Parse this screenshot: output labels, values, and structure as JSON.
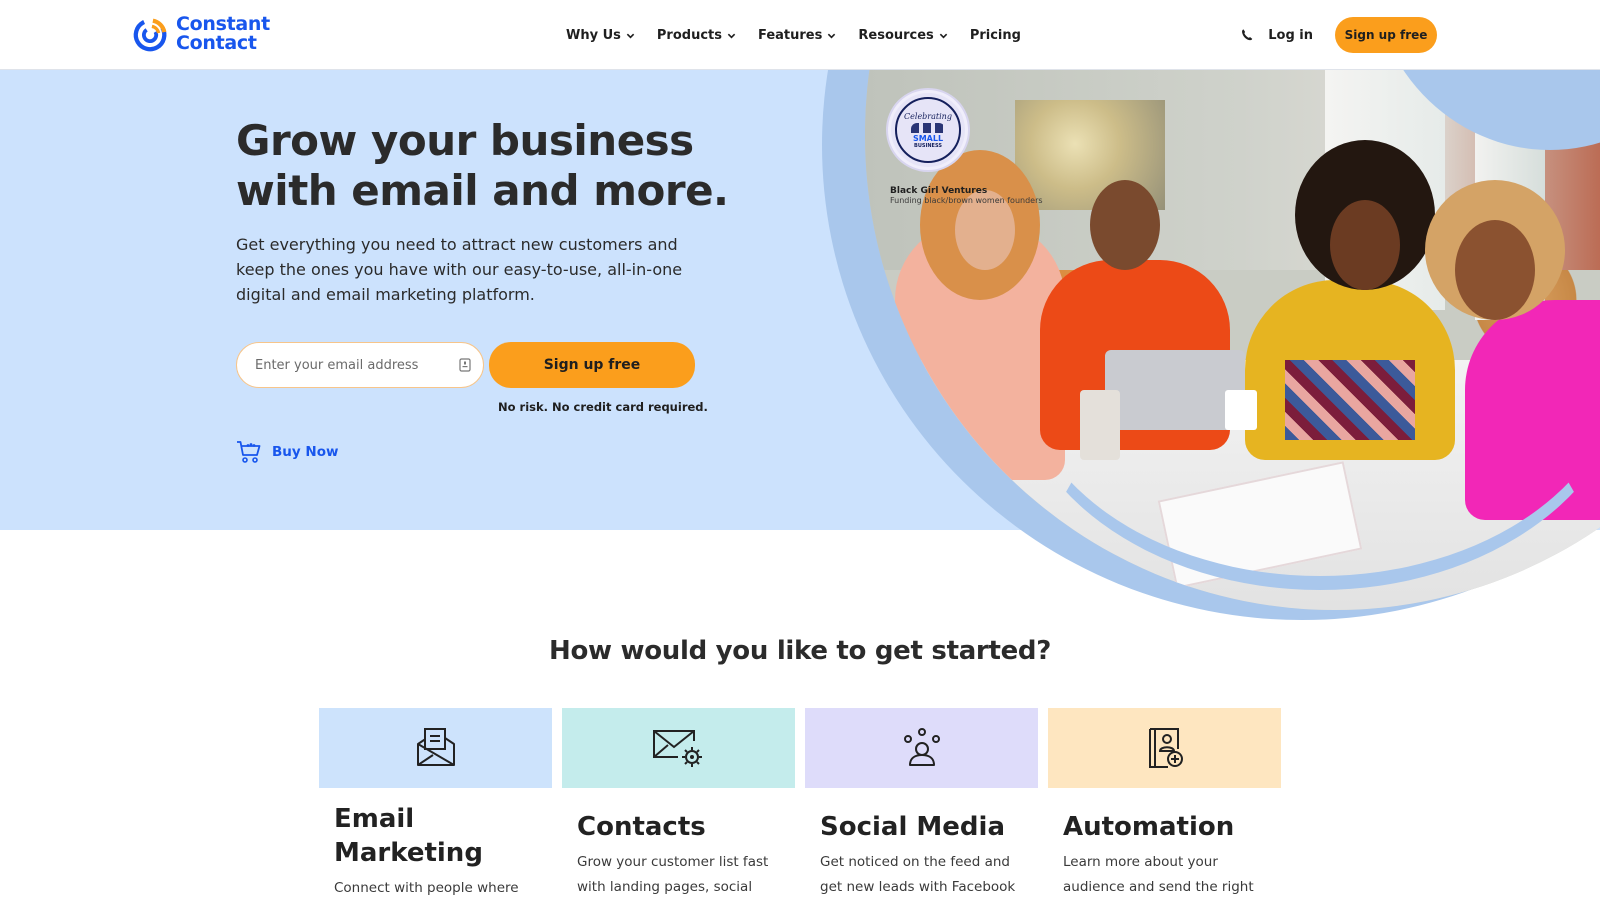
{
  "header": {
    "logo_line1": "Constant",
    "logo_line2": "Contact",
    "nav": [
      {
        "label": "Why Us",
        "has_dropdown": true
      },
      {
        "label": "Products",
        "has_dropdown": true
      },
      {
        "label": "Features",
        "has_dropdown": true
      },
      {
        "label": "Resources",
        "has_dropdown": true
      },
      {
        "label": "Pricing",
        "has_dropdown": false
      }
    ],
    "login_label": "Log in",
    "signup_label": "Sign up free"
  },
  "hero": {
    "title": "Grow your business with email and more.",
    "subtitle": "Get everything you need to attract new customers and keep the ones you have with our easy-to-use, all-in-one digital and email marketing platform.",
    "email_placeholder": "Enter your email address",
    "email_value": "",
    "signup_label": "Sign up free",
    "no_risk": "No risk. No credit card required.",
    "buy_now_label": "Buy Now",
    "badge": {
      "top": "Celebrating",
      "line1": "SMALL",
      "line2": "BUSINESS"
    },
    "caption_title": "Black Girl Ventures",
    "caption_sub": "Funding black/brown women founders"
  },
  "get_started": {
    "title": "How would you like to get started?",
    "cards": [
      {
        "title": "Email Marketing",
        "description": "Connect with people where",
        "icon": "open-envelope-icon",
        "color": "#cde3fc"
      },
      {
        "title": "Contacts",
        "description": "Grow your customer list fast with landing pages, social",
        "icon": "envelope-gear-icon",
        "color": "#c4ecec"
      },
      {
        "title": "Social Media",
        "description": "Get noticed on the feed and get new leads with Facebook",
        "icon": "social-people-icon",
        "color": "#dedcfa"
      },
      {
        "title": "Automation",
        "description": "Learn more about your audience and send the right",
        "icon": "contact-book-add-icon",
        "color": "#fee6c0"
      }
    ]
  },
  "colors": {
    "brand_blue": "#1856ed",
    "accent_orange": "#fb9e1c",
    "hero_bg": "#cce2fd",
    "ring_blue": "#a9c7ec"
  }
}
